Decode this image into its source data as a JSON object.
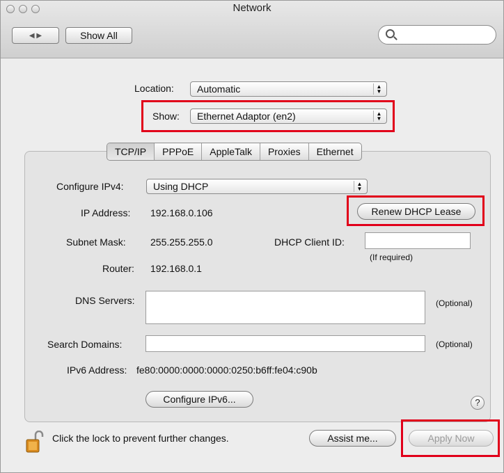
{
  "window": {
    "title": "Network"
  },
  "toolbar": {
    "back_forward": "◀ ▶",
    "show_all_label": "Show All",
    "search_placeholder": ""
  },
  "location": {
    "label": "Location:",
    "value": "Automatic"
  },
  "show": {
    "label": "Show:",
    "value": "Ethernet Adaptor (en2)"
  },
  "tabs": [
    "TCP/IP",
    "PPPoE",
    "AppleTalk",
    "Proxies",
    "Ethernet"
  ],
  "tcpip": {
    "configure_ipv4_label": "Configure IPv4:",
    "configure_ipv4_value": "Using DHCP",
    "ip_address_label": "IP Address:",
    "ip_address_value": "192.168.0.106",
    "renew_dhcp_label": "Renew DHCP Lease",
    "subnet_mask_label": "Subnet Mask:",
    "subnet_mask_value": "255.255.255.0",
    "dhcp_client_id_label": "DHCP Client ID:",
    "dhcp_client_id_value": "",
    "if_required": "(If required)",
    "router_label": "Router:",
    "router_value": "192.168.0.1",
    "dns_servers_label": "DNS Servers:",
    "dns_servers_value": "",
    "optional_1": "(Optional)",
    "search_domains_label": "Search Domains:",
    "search_domains_value": "",
    "optional_2": "(Optional)",
    "ipv6_address_label": "IPv6 Address:",
    "ipv6_address_value": "fe80:0000:0000:0000:0250:b6ff:fe04:c90b",
    "configure_ipv6_label": "Configure IPv6...",
    "help_label": "?"
  },
  "footer": {
    "lock_text": "Click the lock to prevent further changes.",
    "assist_label": "Assist me...",
    "apply_label": "Apply Now"
  },
  "colors": {
    "highlight_box": "#e1001a"
  }
}
